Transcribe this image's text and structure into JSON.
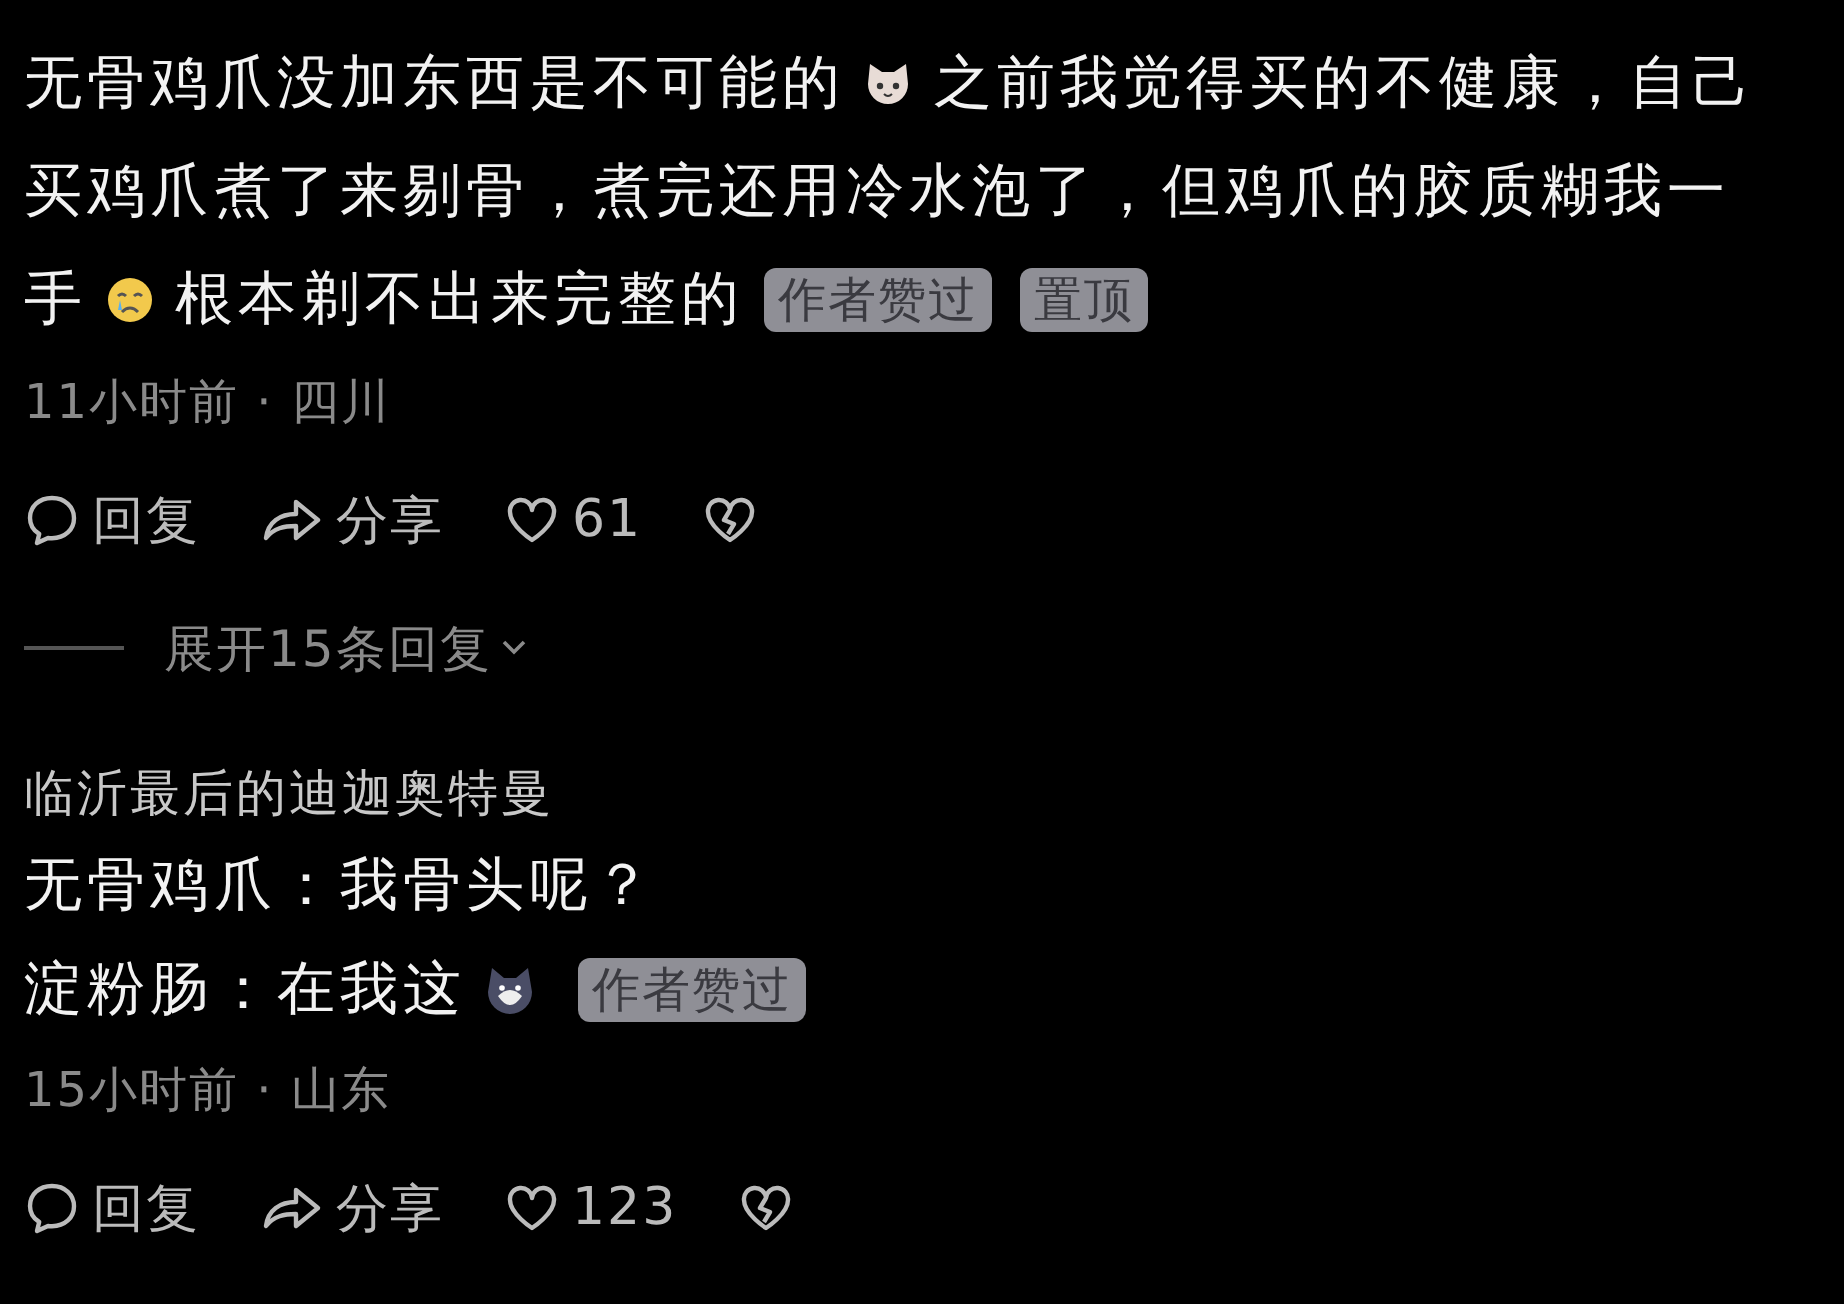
{
  "comments": [
    {
      "lines": [
        [
          {
            "kind": "text",
            "text": "无骨鸡爪没加东西是不可能的"
          },
          {
            "kind": "cat-emoji"
          },
          {
            "kind": "text",
            "text": "之前我觉得买的不健康，自己"
          }
        ],
        [
          {
            "kind": "text",
            "text": "买鸡爪煮了来剔骨，煮完还用冷水泡了，但鸡爪的胶质糊我一"
          }
        ],
        [
          {
            "kind": "text",
            "text": "手"
          },
          {
            "kind": "sad-emoji"
          },
          {
            "kind": "text",
            "text": "根本剃不出来完整的"
          },
          {
            "kind": "badge",
            "text": "作者赞过"
          },
          {
            "kind": "badge",
            "text": "置顶"
          }
        ]
      ],
      "meta": "11小时前 · 四川",
      "actions": [
        {
          "kind": "reply",
          "text": "回复"
        },
        {
          "kind": "share",
          "text": "分享"
        },
        {
          "kind": "like",
          "text": "61"
        },
        {
          "kind": "dislike"
        }
      ],
      "expand": {
        "text": "展开15条回复"
      }
    },
    {
      "author": "临沂最后的迪迦奥特曼",
      "lines": [
        [
          {
            "kind": "text",
            "text": "无骨鸡爪：我骨头呢？"
          }
        ],
        [
          {
            "kind": "text",
            "text": "淀粉肠：在我这"
          },
          {
            "kind": "husky-emoji"
          },
          {
            "kind": "badge",
            "text": "作者赞过"
          }
        ]
      ],
      "meta": "15小时前 · 山东",
      "actions": [
        {
          "kind": "reply",
          "text": "回复"
        },
        {
          "kind": "share",
          "text": "分享"
        },
        {
          "kind": "like",
          "text": "123"
        },
        {
          "kind": "dislike"
        }
      ]
    }
  ]
}
